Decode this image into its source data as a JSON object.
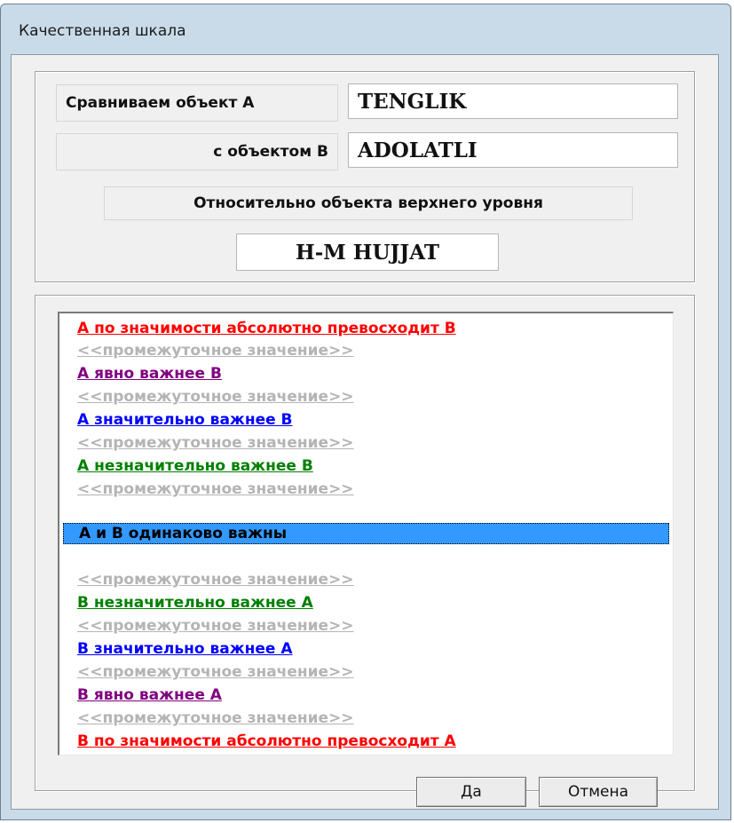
{
  "window": {
    "title": "Качественная шкала"
  },
  "comparison": {
    "object_a_label": "Сравниваем объект  A",
    "object_a_value": "TENGLIK",
    "object_b_label": "с объектом  B",
    "object_b_value": "ADOLATLI",
    "parent_label": "Относительно объекта верхнего уровня",
    "parent_value": "H-M HUJJAT"
  },
  "scale": {
    "items": [
      {
        "label": "A по значимости абсолютно превосходит B",
        "color": "#ff0000"
      },
      {
        "label": "<<промежуточное значение>>",
        "color": "#b4b4b4"
      },
      {
        "label": "A явно важнее B",
        "color": "#800080"
      },
      {
        "label": "<<промежуточное значение>>",
        "color": "#b4b4b4"
      },
      {
        "label": "A значительно важнее B",
        "color": "#0000ff"
      },
      {
        "label": "<<промежуточное значение>>",
        "color": "#b4b4b4"
      },
      {
        "label": "A незначительно важнее B",
        "color": "#008000"
      },
      {
        "label": "<<промежуточное значение>>",
        "color": "#b4b4b4"
      },
      {
        "label": "A и B одинаково важны",
        "color": "#000000",
        "selected": true
      },
      {
        "label": "<<промежуточное значение>>",
        "color": "#b4b4b4"
      },
      {
        "label": "B незначительно важнее A",
        "color": "#008000"
      },
      {
        "label": "<<промежуточное значение>>",
        "color": "#b4b4b4"
      },
      {
        "label": "B значительно важнее A",
        "color": "#0000ff"
      },
      {
        "label": "<<промежуточное значение>>",
        "color": "#b4b4b4"
      },
      {
        "label": "B явно важнее A",
        "color": "#800080"
      },
      {
        "label": "<<промежуточное значение>>",
        "color": "#b4b4b4"
      },
      {
        "label": "B по значимости абсолютно превосходит A",
        "color": "#ff0000"
      }
    ],
    "selection_color": "#3399ff"
  },
  "buttons": {
    "ok": "Да",
    "cancel": "Отмена"
  }
}
